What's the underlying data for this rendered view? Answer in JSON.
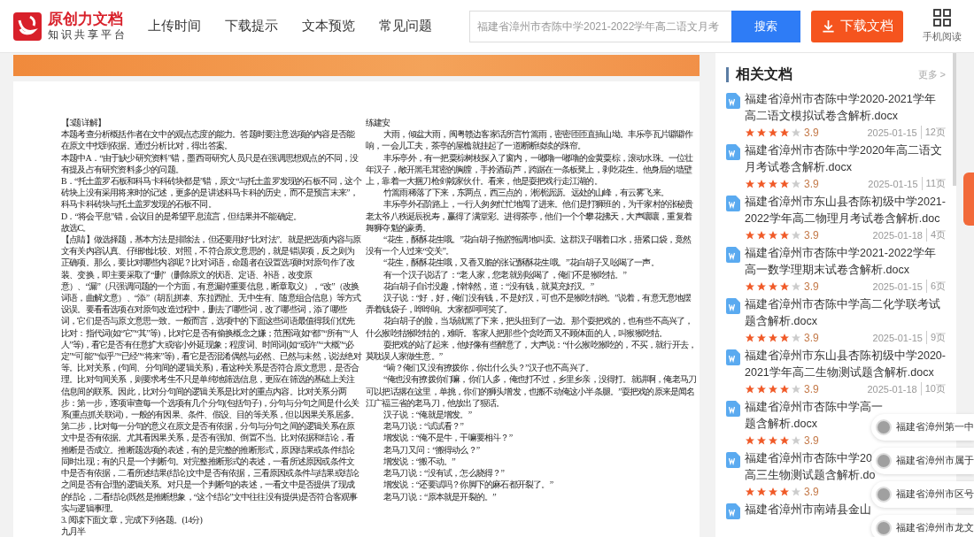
{
  "header": {
    "logo": {
      "title": "原创力文档",
      "subtitle": "知识共享平台"
    },
    "nav": [
      {
        "label": "上传时间"
      },
      {
        "label": "下载提示"
      },
      {
        "label": "文本预览"
      },
      {
        "label": "常见问题"
      }
    ],
    "search": {
      "placeholder": "福建省漳州市杏陈中学2021-2022学年高二语文月考",
      "button": "搜索"
    },
    "download": "下载文档",
    "mobile": "手机阅读"
  },
  "document": {
    "columns": [
      {
        "paragraphs": [
          {
            "text": "【3题详解】",
            "indent": false
          },
          {
            "text": "本题考查分析概括作者在文中的观点态度的能力。答题时要注意选项的内容是否能在原文中找到依据。通过分析比对，得出答案。",
            "indent": false
          },
          {
            "text": "本题中A．“由于缺少研究资料”错，墨西哥研究人员只是在强调思想观点的不同，没有提及占有研究资料多少的问题。",
            "indent": false
          },
          {
            "text": "B．“托土盖罗石板和科马卡科砖块都是”错，原文“与托土盖罗发现的石板不同，这个砖块上没有采用将来时的记述，更多的是讲述科马卡科的历史，而不是预言末来”，科马卡科砖块与托土盖罗发现的石板不同。",
            "indent": false
          },
          {
            "text": "D．“将会平息”错，会议目的是希望平息流言，但结果并不能确定。",
            "indent": false
          },
          {
            "text": "故选C。",
            "indent": false
          },
          {
            "text": "【点睛】做选择题，基本方法是排除法，但还要用好“比对法”。就是把选项内容与原文有关内容认真、仔细地比较、对照，不符合原文意思的，就是错误项，反之则为正确项。那么，要比对哪些内容呢？比对词语，命题者在设置选项时对原句作了改装、变换，即主要采取了“删”（删除原文的状语、定语、补语，改变原意）、“漏”（只强调问题的一个方面，有意漏掉重要信息，断章取义），“改”（改换词语，曲解文意）、“添”（胡乱拼凑、东拉西扯、无中生有、随意组合信息）等方式设误。要看看选项在对原句改造过程中，删去了哪些词，改了哪些词，添了哪些词，它们是否与原文意思一致。一般而言，选项中的下面这些词语最值得我们优先比对：指代词(如“它”“其”等)，比对它是否有偷换概念之嫌；范围词(如“都”“所有”“人人”等)，看它是否有任意扩大或缩小外延现象；程度词、时间词(如“或许”“大概”“必定”“可能”“似乎”“已经”“将来”等)，看它是否混淆偶然与必然、已然与未然，说法绝对等。比对关系，(句间、分句间的逻辑关系)，看这种关系是否符合原文意思，是否合理。比对句间关系，则要求考生不只是单纯地筛选信息，更应在筛选的基础上关注信息间的联系。因此，比对分句间的逻辑关系是比对的重点内容。比对关系分两步：第一步，逐项审查每一个选项有几个分句(包括句子)，分句与分句之间是什么关系(重点抓关联词)，一般的有因果、条件、假设、目的等关系，但以因果关系居多。第二步，比对每一分句的意义在原文是否有依据，分句与分句之间的逻辑关系在原文中是否有依据。尤其看因果关系，是否有强加、倒置不当。比对依据和结论，看推断是否成立。推断题选项的表述，有的是完整的推断形式，原因结果或条件结论同时出现；有的只是一个判断句。对完整推断形式的表述，一看所述原因或条件文中是否有依据，二看所述结果(结论)文中是否有依据，三看原因或条件与结果或结论之间是否有合理的逻辑关系。对只是一个判断句的表述，一看文中是否提供了现成的结论，二看结论(既然是推断想象，“这个结论”文中往往没有提供)是否符合客观事实与逻辑事理。",
            "indent": false
          },
          {
            "text": "3. 阅读下面文章，完成下列各题。(14分)",
            "indent": false
          },
          {
            "text": "九月半",
            "indent": false
          }
        ]
      },
      {
        "paragraphs": [
          {
            "text": "练建安",
            "indent": false
          },
          {
            "text": "大雨，倾盆大雨，闽粤赣边客家话所言竹篙雨，密密匝匝直插山坳。丰乐亭瓦片噼噼作响，一会儿工夫，茶亭的屋檐就挂起了一道断断续续的珠帘。",
            "indent": true
          },
          {
            "text": "丰乐亭外，有一把粟棕树枝探入了窗内，一嘟噜一嘟噜的金黄粟棕，滚动水珠。一位壮年汉子，敞开黑毛茸密的胸膛，手拎酒葫芦，跨踞在一条板凳上，剥吃花生。他身后的墙壁上，靠着一大捆刀枪剑戟家伙什。看来，他是耍把戏行走江湖的。",
            "indent": true
          },
          {
            "text": "竹篙雨稀落了下来，东两点，西三点的，淅淅沥沥。远处的山峰，有云雾飞来。",
            "indent": true
          },
          {
            "text": "丰乐亭外石阶路上，一行人匆匆忙忙地闯了进来。他们是打狮班的，为千家村的张秘贵老太爷八秩诞辰祝寿，赢得了满堂彩。进得茶亭，他们一个个攀花拂天，大声嚷嚷，重复着舞狮夺魁的豪勇。",
            "indent": true
          },
          {
            "text": "“花生，酥酥花生哦。”花白胡子拖腔拖调地叫卖。这群汉子咽着口水，捂紧口袋，竟然没有一个人过来“交关”。",
            "indent": true
          },
          {
            "text": "“花生，酥酥花生哦，又香又脆的张记酥酥花生哦。”花白胡子又吆喝了一声。",
            "indent": true
          },
          {
            "text": "有一个汉子说话了：“老人家，您老就别吆喝了，俺们不是猴吃牯。”",
            "indent": true
          },
          {
            "text": "花白胡子自讨没趣，悻悻然，道：“没有钱，就莫充好汉。”",
            "indent": true
          },
          {
            "text": "汉子说：“好，好，俺们没有钱，不是好汉，可也不是猴吃牯哟。”说着，有意无意地摆弄着钱袋子，哗哗响。大家都呵呵笑了。",
            "indent": true
          },
          {
            "text": "花白胡子的脸，当场就黑了下来，把头扭到了一边。那个耍把戏的，也有些不高兴了，什么猴吃牯猴吃牯的，难听。客家人把那些个贪吃而又不顾体面的人，叫猴猴吃牯。",
            "indent": true
          },
          {
            "text": "耍把戏的站了起来，他好像有些醉意了，大声说：“什么猴吃猴吃的，不买，就行开去，莫耽误人家做生意。”",
            "indent": true
          },
          {
            "text": "“嗬？俺们又没有撩拨你，你出什么头？”汉子也不高兴了。",
            "indent": true
          },
          {
            "text": "“俺也没有撩拨你们嘛，你们人多，俺也打不过，乡里乡亲，没得打。就讲啊，俺老马刀可以把话撂在这里，单挑，你们的狮头增发，也搬不动俺这小半条腿。”耍把戏的原来是闻名江广福三省的老马刀，他放出了狠话。",
            "indent": true
          },
          {
            "text": "汉子说：“俺就是增发。”",
            "indent": true
          },
          {
            "text": "老马刀说：“试试看？”",
            "indent": true
          },
          {
            "text": "增发说：“俺不是牛，干嘛要相斗？”",
            "indent": true
          },
          {
            "text": "老马刀又问：“搬得动么？”",
            "indent": true
          },
          {
            "text": "增发说：“搬不动。”",
            "indent": true
          },
          {
            "text": "老马刀说：“没有试，怎么晓得？”",
            "indent": true
          },
          {
            "text": "增发说：“还要试吗？你脚下的麻石都开裂了。”",
            "indent": true
          },
          {
            "text": "老马刀说：“原本就是开裂的。”",
            "indent": true
          }
        ]
      }
    ]
  },
  "related": {
    "title": "相关文档",
    "more": "更多 >",
    "items": [
      {
        "lines": [
          "福建省漳州市杏陈中学2020-2021学年",
          "高二语文模拟试卷含解析.docx"
        ],
        "stars": 4,
        "rating": "3.9",
        "date": "2025-01-15",
        "pages": "12页"
      },
      {
        "lines": [
          "福建省漳州市杏陈中学2020年高二语文",
          "月考试卷含解析.docx"
        ],
        "stars": 4,
        "rating": "3.9",
        "date": "2025-01-15",
        "pages": "11页"
      },
      {
        "lines": [
          "福建省漳州市东山县杏陈初级中学2021-",
          "2022学年高二物理月考试卷含解析.doc"
        ],
        "stars": 4,
        "rating": "3.9",
        "date": "2025-01-18",
        "pages": "4页"
      },
      {
        "lines": [
          "福建省漳州市杏陈中学2021-2022学年",
          "高一数学理期末试卷含解析.docx"
        ],
        "stars": 4,
        "rating": "3.9",
        "date": "2025-01-15",
        "pages": "6页"
      },
      {
        "lines": [
          "福建省漳州市杏陈中学高二化学联考试",
          "题含解析.docx"
        ],
        "stars": 4,
        "rating": "3.9",
        "date": "2025-01-15",
        "pages": "9页"
      },
      {
        "lines": [
          "福建省漳州市东山县杏陈初级中学2020-",
          "2021学年高二生物测试题含解析.docx"
        ],
        "stars": 4,
        "rating": "3.9",
        "date": "2025-01-18",
        "pages": "10页"
      },
      {
        "lines": [
          "福建省漳州市杏陈中学高一",
          "题含解析.docx"
        ],
        "stars": 4,
        "rating": "3.9"
      },
      {
        "lines": [
          "福建省漳州市杏陈中学20",
          "高三生物测试题含解析.do"
        ],
        "stars": 4,
        "rating": "3.9"
      },
      {
        "lines": [
          "福建省漳州市南靖县金山"
        ]
      }
    ]
  },
  "floating": [
    {
      "text": "福建省漳州第一中"
    },
    {
      "text": "福建省漳州市属于"
    },
    {
      "text": "福建省漳州市区号"
    },
    {
      "text": "福建省漳州市龙文"
    }
  ]
}
